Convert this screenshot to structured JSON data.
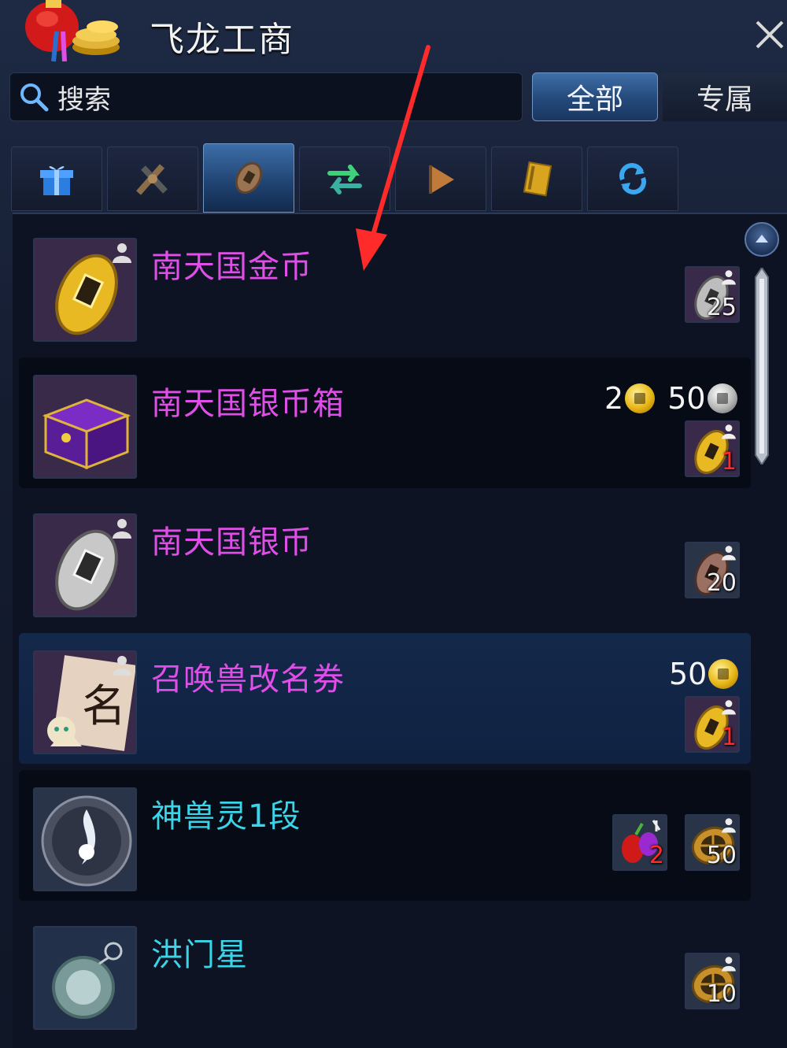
{
  "window": {
    "title": "飞龙工商"
  },
  "search": {
    "placeholder": "搜索"
  },
  "filters": {
    "all_label": "全部",
    "own_label": "专属"
  },
  "tabs": [
    {
      "icon": "gift-box-icon"
    },
    {
      "icon": "weapon-icon"
    },
    {
      "icon": "coin-icon",
      "active": true
    },
    {
      "icon": "exchange-arrows-icon"
    },
    {
      "icon": "flag-icon"
    },
    {
      "icon": "book-icon"
    },
    {
      "icon": "refresh-icon"
    }
  ],
  "items": [
    {
      "name": "南天国金币",
      "icon": "gold-coin-icon",
      "cost": {
        "icon": "silver-coin-icon",
        "qty": "25"
      }
    },
    {
      "name": "南天国银币箱",
      "icon": "purple-chest-icon",
      "price": {
        "gold": "2",
        "silver": "50"
      },
      "cost": {
        "icon": "gold-coin-icon",
        "qty": "1"
      }
    },
    {
      "name": "南天国银币",
      "icon": "silver-coin-icon",
      "cost": {
        "icon": "copper-coin-icon",
        "qty": "20"
      }
    },
    {
      "name": "召唤兽改名券",
      "icon": "rename-scroll-icon",
      "price": {
        "gold": "50"
      },
      "cost": {
        "icon": "gold-coin-icon",
        "qty": "1"
      }
    },
    {
      "name": "神兽灵1段",
      "icon": "spirit-orb-icon",
      "cost": {
        "icon": "bronze-medal-icon",
        "qty": "50"
      },
      "cost2": {
        "icon": "fruit-icon",
        "qty": "2"
      }
    },
    {
      "name": "洪门星",
      "icon": "star-orb-icon",
      "cost": {
        "icon": "bronze-medal-icon",
        "qty": "10"
      }
    }
  ],
  "colors": {
    "item_name_magenta": "#e04ee8",
    "item_name_cyan": "#3ad5e8",
    "annotation_arrow": "#ff2a2a"
  }
}
